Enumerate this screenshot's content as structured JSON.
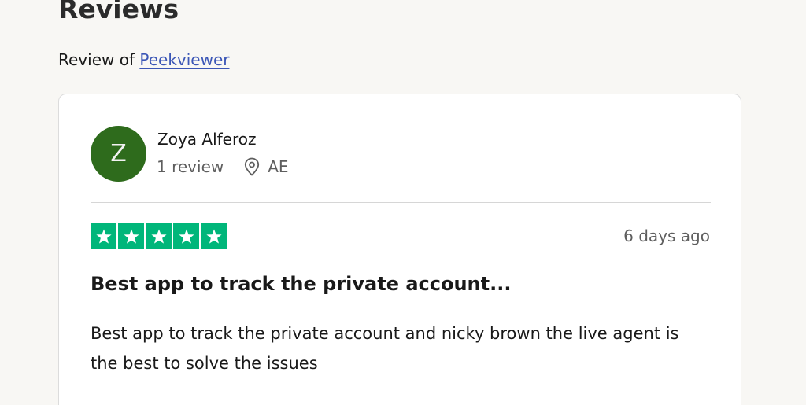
{
  "page": {
    "heading": "Reviews",
    "review_of_prefix": "Review of ",
    "business_name": "Peekviewer"
  },
  "review": {
    "author": {
      "initial": "Z",
      "name": "Zoya Alferoz",
      "review_count": "1 review",
      "country": "AE",
      "avatar_color": "#2e6b1c"
    },
    "rating": 5,
    "rating_max": 5,
    "star_color": "#00b67a",
    "date": "6 days ago",
    "title": "Best app to track the private account...",
    "body": "Best app to track the private account and nicky brown the live agent is the best to solve the issues",
    "icons": {
      "location": "location-pin-icon",
      "star": "star-icon"
    }
  },
  "colors": {
    "background": "#f8f7f4",
    "link": "#3b56b6"
  }
}
